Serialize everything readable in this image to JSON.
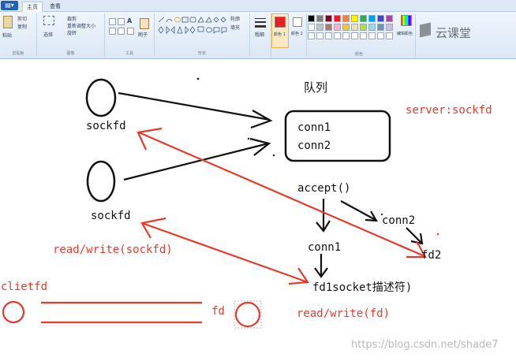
{
  "ribbon": {
    "app_button": "▤▾",
    "tabs": [
      "主页",
      "查看"
    ],
    "groups": [
      "剪贴板",
      "图像",
      "工具",
      "形状",
      "颜色"
    ],
    "clipboard": {
      "paste": "粘贴",
      "cut": "剪切",
      "copy": "复制"
    },
    "image": {
      "select": "选择",
      "crop": "裁剪",
      "resize": "重新调整大小",
      "rotate": "旋转"
    },
    "tools_brush": "刷子",
    "shapes": {
      "outline": "轮廓",
      "fill": "填充"
    },
    "size": "粗细",
    "color1": "颜色 1",
    "color2": "颜色 2",
    "edit_colors": "编辑颜色",
    "brand": "云课堂"
  },
  "colors": {
    "palette_row1": [
      "#000000",
      "#7f7f7f",
      "#880015",
      "#ed1c24",
      "#ff7f27",
      "#fff200",
      "#22b14c",
      "#00a2e8",
      "#3f48cc",
      "#a349a4"
    ],
    "palette_row2": [
      "#ffffff",
      "#c3c3c3",
      "#b97a57",
      "#ffaec9",
      "#ffc90e",
      "#efe4b0",
      "#b5e61d",
      "#99d9ea",
      "#7092be",
      "#c8bfe7"
    ],
    "color1": "#ed1c24",
    "color2": "#ffffff"
  },
  "canvas": {
    "queue_title": "队列",
    "queue_items": [
      "conn1",
      "conn2"
    ],
    "server_label": "server:sockfd",
    "sockfd_top": "sockfd",
    "sockfd_bottom": "sockfd",
    "accept": "accept()",
    "conn2": "conn2",
    "conn1": "conn1",
    "fd2": "fd2",
    "fd1_desc": "fd1socket描述符)",
    "read_write_sockfd": "read/write(sockfd)",
    "clietfd": "clietfd",
    "fd": "fd",
    "read_write_fd": "read/write(fd)"
  },
  "watermark": "https://blog.csdn.net/shade7"
}
